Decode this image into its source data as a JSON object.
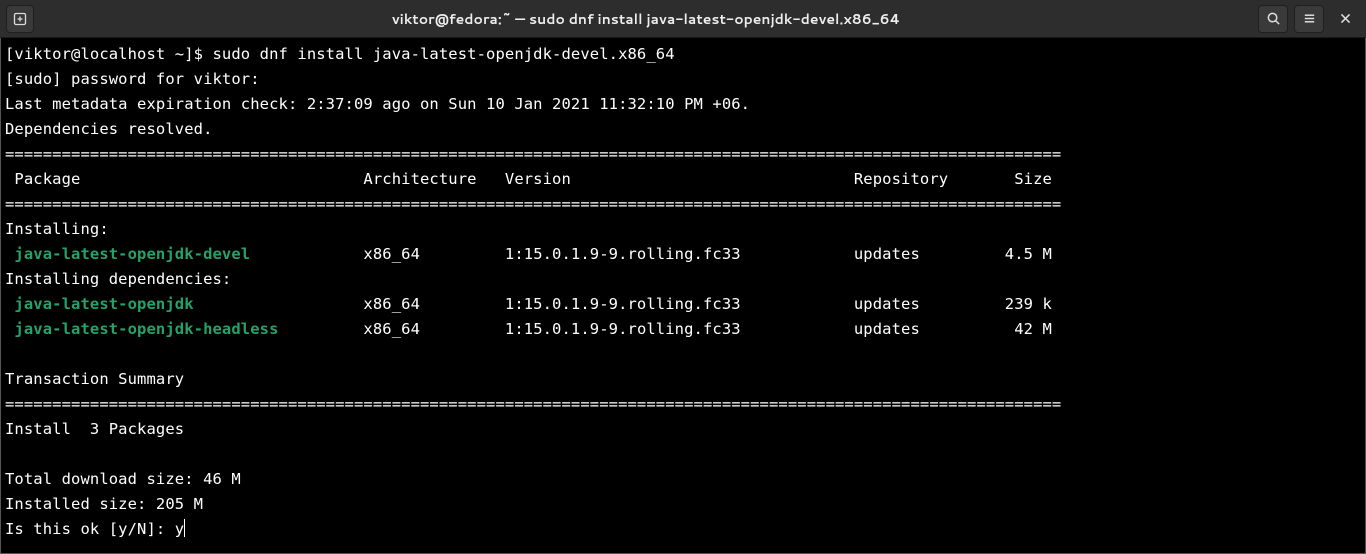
{
  "window": {
    "title": "viktor@fedora:~ — sudo dnf install java-latest-openjdk-devel.x86_64"
  },
  "prompt": {
    "user_host": "[viktor@localhost ~]$ ",
    "command": "sudo dnf install java-latest-openjdk-devel.x86_64"
  },
  "output": {
    "sudo_line": "[sudo] password for viktor: ",
    "metadata_line": "Last metadata expiration check: 2:37:09 ago on Sun 10 Jan 2021 11:32:10 PM +06.",
    "deps_resolved": "Dependencies resolved.",
    "header": {
      "package": "Package",
      "arch": "Architecture",
      "version": "Version",
      "repo": "Repository",
      "size": "Size"
    },
    "installing_label": "Installing:",
    "installing_deps_label": "Installing dependencies:",
    "packages": [
      {
        "name": "java-latest-openjdk-devel",
        "arch": "x86_64",
        "version": "1:15.0.1.9-9.rolling.fc33",
        "repo": "updates",
        "size": "4.5 M"
      },
      {
        "name": "java-latest-openjdk",
        "arch": "x86_64",
        "version": "1:15.0.1.9-9.rolling.fc33",
        "repo": "updates",
        "size": "239 k"
      },
      {
        "name": "java-latest-openjdk-headless",
        "arch": "x86_64",
        "version": "1:15.0.1.9-9.rolling.fc33",
        "repo": "updates",
        "size": "42 M"
      }
    ],
    "trans_summary": "Transaction Summary",
    "install_count": "Install  3 Packages",
    "total_download": "Total download size: 46 M",
    "installed_size": "Installed size: 205 M",
    "confirm_prompt": "Is this ok [y/N]: ",
    "confirm_answer": "y"
  }
}
